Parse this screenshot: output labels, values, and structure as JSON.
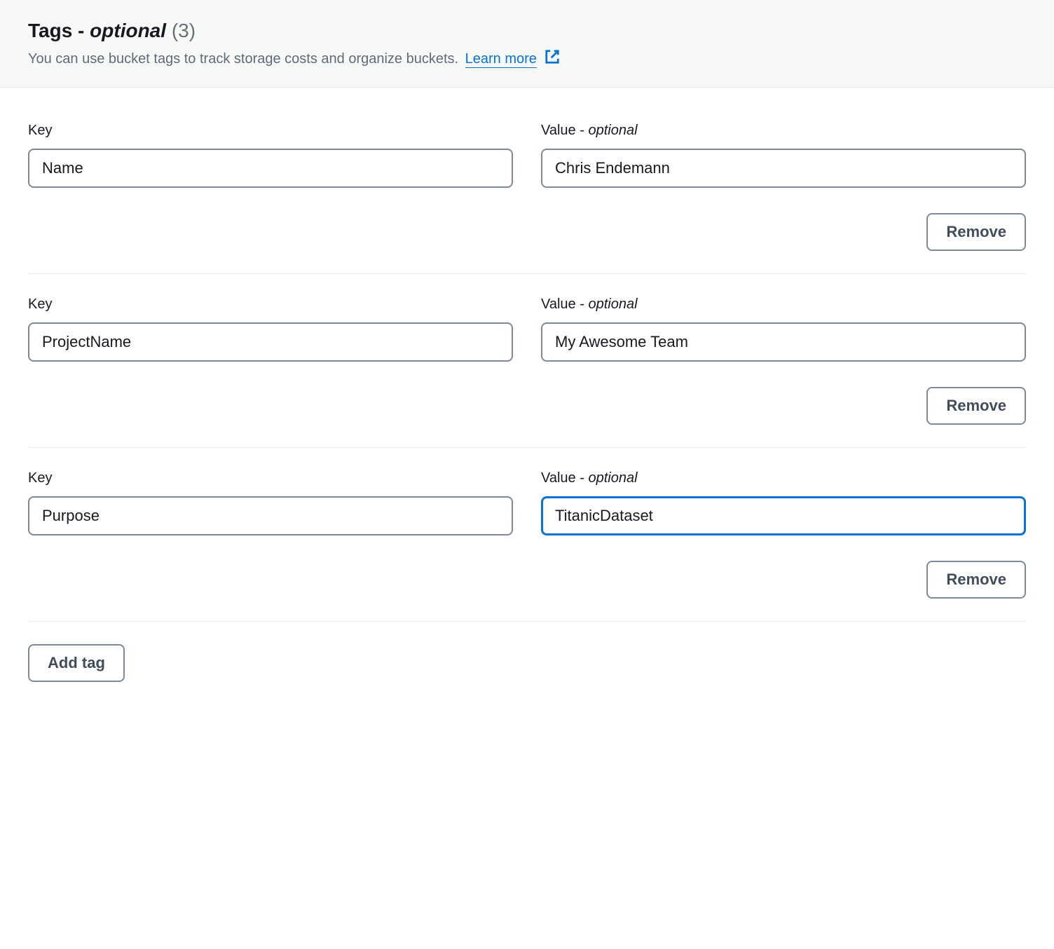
{
  "header": {
    "titlePrefix": "Tags - ",
    "titleOptional": "optional",
    "count": "(3)",
    "subtitle": "You can use bucket tags to track storage costs and organize buckets.",
    "learnMore": "Learn more"
  },
  "labels": {
    "key": "Key",
    "valuePrefix": "Value - ",
    "valueOptional": "optional",
    "remove": "Remove",
    "addTag": "Add tag"
  },
  "tags": [
    {
      "key": "Name",
      "value": "Chris Endemann",
      "focused": false
    },
    {
      "key": "ProjectName",
      "value": "My Awesome Team",
      "focused": false
    },
    {
      "key": "Purpose",
      "value": "TitanicDataset",
      "focused": true
    }
  ]
}
